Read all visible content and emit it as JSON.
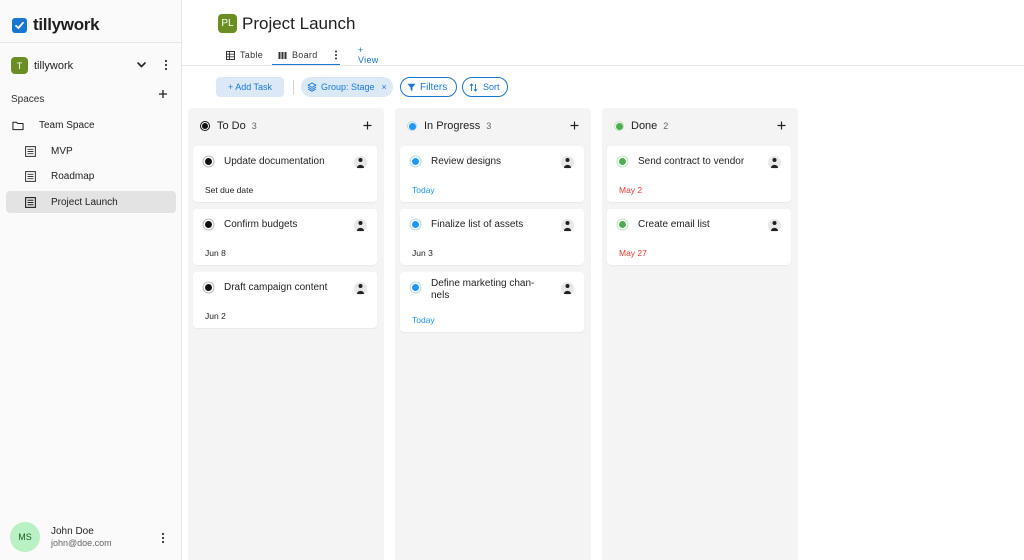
{
  "app": {
    "name": "tillywork"
  },
  "workspace": {
    "avatar_letter": "T",
    "name": "tillywork"
  },
  "sidebar": {
    "spaces_label": "Spaces",
    "items": [
      {
        "label": "Team Space",
        "icon": "folder-icon"
      },
      {
        "label": "MVP",
        "icon": "list-icon"
      },
      {
        "label": "Roadmap",
        "icon": "list-icon"
      },
      {
        "label": "Project Launch",
        "icon": "list-icon",
        "active": true
      }
    ]
  },
  "user": {
    "initials": "MS",
    "name": "John Doe",
    "email": "john@doe.com"
  },
  "project": {
    "avatar": "PL",
    "title": "Project Launch"
  },
  "tabs": {
    "table": "Table",
    "board": "Board",
    "view": "+ View"
  },
  "toolbar": {
    "add_task": "+ Add Task",
    "group_chip": "Group: Stage",
    "group_chip_close": "×",
    "filters": "Filters",
    "sort": "Sort"
  },
  "colors": {
    "accent": "#1976d2",
    "todo": "#111111",
    "in_progress": "#2196f3",
    "done": "#4caf50",
    "due_overdue": "#e53935"
  },
  "columns": [
    {
      "title": "To Do",
      "count": "3",
      "status": "todo",
      "cards": [
        {
          "title": "Update documentation",
          "meta": "Set due date"
        },
        {
          "title": "Confirm budgets",
          "meta": "Jun 8"
        },
        {
          "title": "Draft campaign content",
          "meta": "Jun 2"
        }
      ]
    },
    {
      "title": "In Progress",
      "count": "3",
      "status": "in_progress",
      "cards": [
        {
          "title": "Review designs",
          "meta": "Today"
        },
        {
          "title": "Finalize list of assets",
          "meta": "Jun 3"
        },
        {
          "title": "Define marketing chan-nels",
          "meta": "Today"
        }
      ]
    },
    {
      "title": "Done",
      "count": "2",
      "status": "done",
      "cards": [
        {
          "title": "Send contract to vendor",
          "meta": "May 2"
        },
        {
          "title": "Create email list",
          "meta": "May 27"
        }
      ]
    }
  ]
}
